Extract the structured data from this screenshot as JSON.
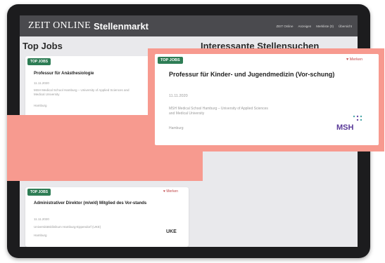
{
  "header": {
    "logo": "ZEIT ONLINE",
    "logo_sub": "Stellenmarkt",
    "nav": [
      "ZEIT Online",
      "Anzeigen",
      "Merkliste (0)",
      "Übersicht"
    ]
  },
  "sections": {
    "top_jobs": "Top Jobs",
    "interesting": "Interessante Stellensuchen"
  },
  "badge_label": "TOP JOBS",
  "merken_label": "♥ Merken",
  "cards": [
    {
      "title": "Professur für Anästhesiologie",
      "date": "11.11.2020",
      "employer": "MSH Medical School Hamburg – University of Applied Sciences and Medical University",
      "location": "Hamburg"
    },
    {
      "title": "Professur für Kinder- und Jugendmedizin (Vor-schung)",
      "date": "11.11.2020",
      "employer": "MSH Medical School Hamburg – University of Applied Sciences and Medical University",
      "location": "Hamburg",
      "logo": "MSH"
    },
    {
      "title": "Administrativer Direktor (m/w/d) Mitglied des Vor-stands",
      "date": "11.11.2020",
      "employer": "Universitätsklinikum Hamburg-Eppendorf (UKE)",
      "location": "Hamburg",
      "logo": "UKE"
    }
  ],
  "colors": {
    "accent_green": "#2e7d55",
    "highlight": "#f79a8f",
    "topbar": "#4a4a4e"
  }
}
